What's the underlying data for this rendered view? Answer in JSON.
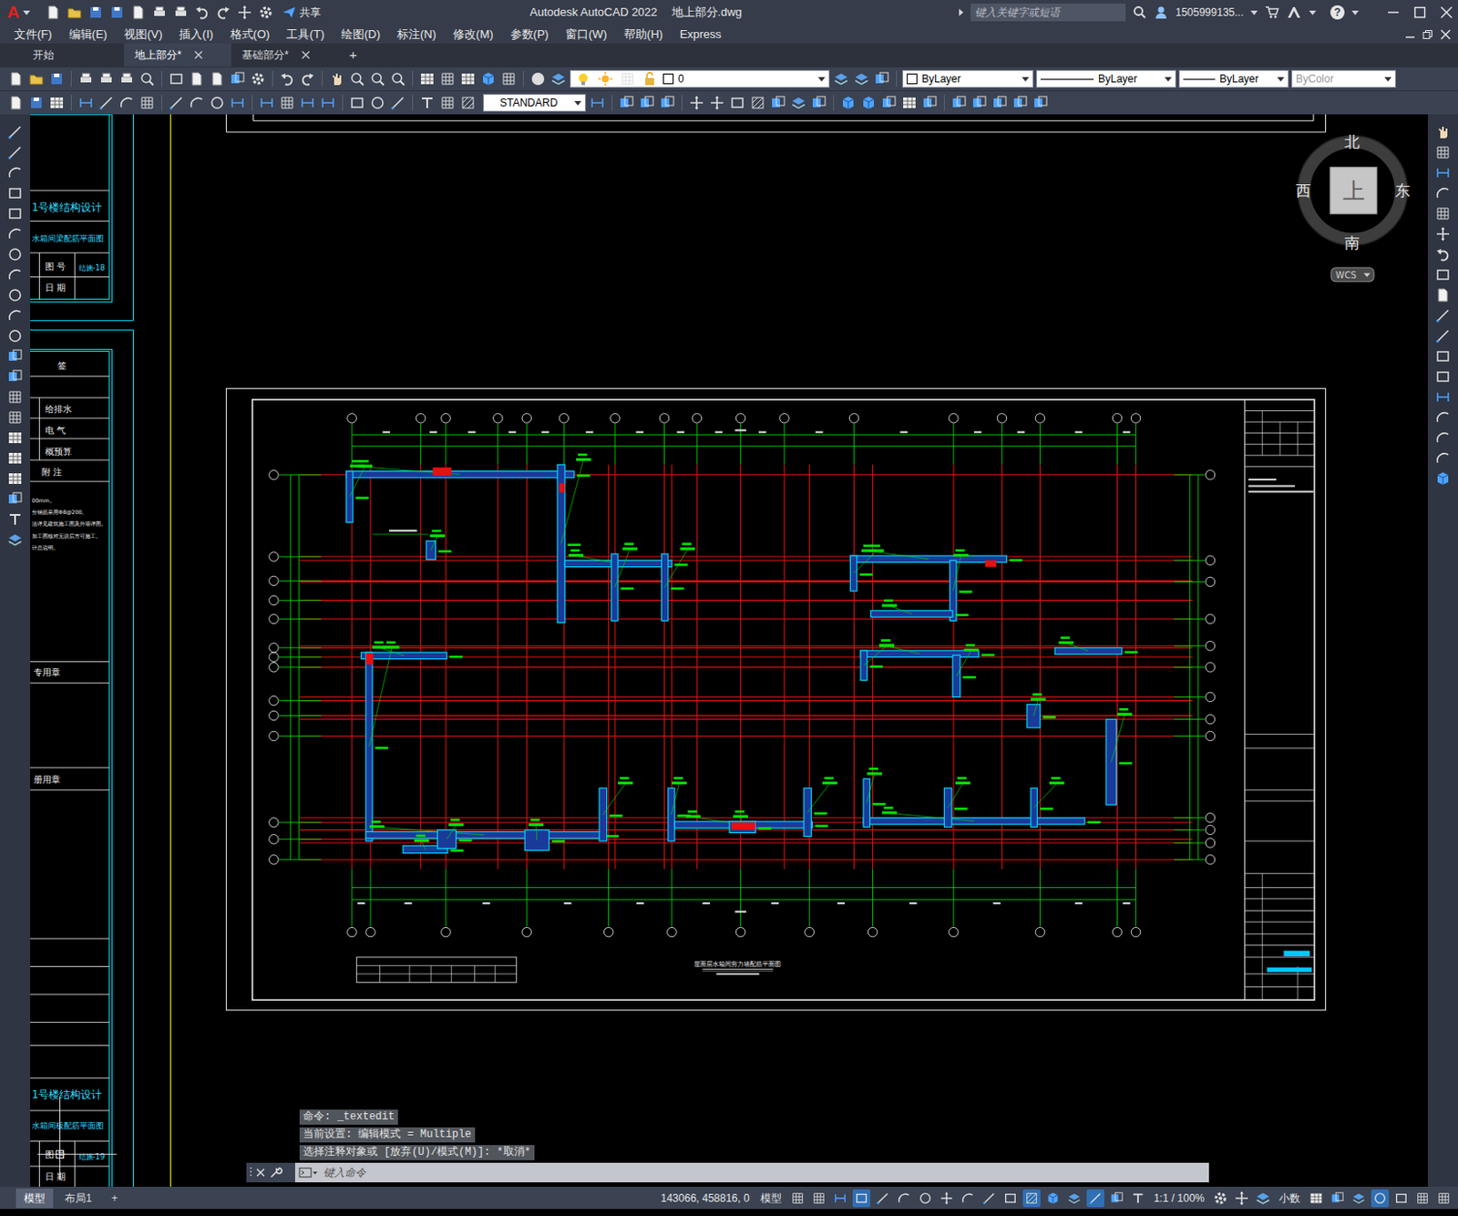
{
  "window": {
    "logo": "A",
    "share": "共享",
    "title": "Autodesk AutoCAD 2022",
    "file": "地上部分.dwg",
    "search_placeholder": "键入关键字或短语",
    "user": "1505999135...",
    "help": "?"
  },
  "menu": [
    "文件(F)",
    "编辑(E)",
    "视图(V)",
    "插入(I)",
    "格式(O)",
    "工具(T)",
    "绘图(D)",
    "标注(N)",
    "修改(M)",
    "参数(P)",
    "窗口(W)",
    "帮助(H)",
    "Express"
  ],
  "doc_tabs": [
    {
      "label": "开始",
      "selected": false,
      "closable": false
    },
    {
      "label": "地上部分*",
      "selected": true,
      "closable": true
    },
    {
      "label": "基础部分*",
      "selected": false,
      "closable": true
    }
  ],
  "new_tab": "+",
  "properties": {
    "layer": "0",
    "color": "ByLayer",
    "linetype": "ByLayer",
    "lineweight": "ByLayer",
    "plotstyle": {
      "label": "ByColor",
      "disabled": true
    },
    "textstyle": "STANDARD"
  },
  "viewcube": {
    "north": "北",
    "south": "南",
    "west": "西",
    "east": "东",
    "top": "上",
    "ucs": "WCS"
  },
  "sheet_blocks": [
    {
      "project": "1号楼结构设计",
      "drawing": "水箱间梁配筋平面图",
      "no_label": "图 号",
      "no": "结施-18",
      "date_label": "日 期"
    },
    {
      "project": "1号楼结构设计",
      "drawing": "水箱间板配筋平面图",
      "no_label": "图 号",
      "no": "结施-19",
      "date_label": "日 期"
    }
  ],
  "sign_block": {
    "header": "签",
    "rows": [
      "给排水",
      "电 气",
      "概预算"
    ],
    "notes_label": "附 注",
    "notes": [
      "00mm。",
      "分钢筋采用Φ8@200。",
      "法详见建筑施工图及外墙详图。",
      "加工图核对无误后方可施工。",
      "计总说明。"
    ],
    "stamps": [
      "专用章",
      "册用章"
    ]
  },
  "drawing": {
    "title": "屋面层水箱间剪力墙配筋平面图"
  },
  "command": {
    "history": [
      "命令: _textedit",
      "当前设置: 编辑模式 = Multiple",
      "选择注释对象或 [放弃(U)/模式(M)]: *取消*"
    ],
    "placeholder": "键入命令"
  },
  "status": {
    "layouts": [
      {
        "label": "模型",
        "selected": true
      },
      {
        "label": "布局1",
        "selected": false
      }
    ],
    "add_layout": "+",
    "coords": "143066, 458816, 0",
    "space": "模型",
    "scale": "1:1 / 100%",
    "units": "小数",
    "toggles_a": [
      {
        "on": false
      },
      {
        "on": false
      },
      {
        "on": false
      },
      {
        "on": true
      },
      {
        "on": false
      },
      {
        "on": false
      },
      {
        "on": false
      },
      {
        "on": false
      },
      {
        "on": false
      },
      {
        "on": false
      },
      {
        "on": false
      },
      {
        "on": true
      },
      {
        "on": false
      },
      {
        "on": false
      },
      {
        "on": true
      },
      {
        "on": false
      },
      {
        "on": false
      }
    ],
    "toggles_b": [
      {
        "on": false
      },
      {
        "on": false
      },
      {
        "on": false
      },
      {
        "on": true
      },
      {
        "on": false
      },
      {
        "on": false
      },
      {
        "on": false
      }
    ]
  }
}
